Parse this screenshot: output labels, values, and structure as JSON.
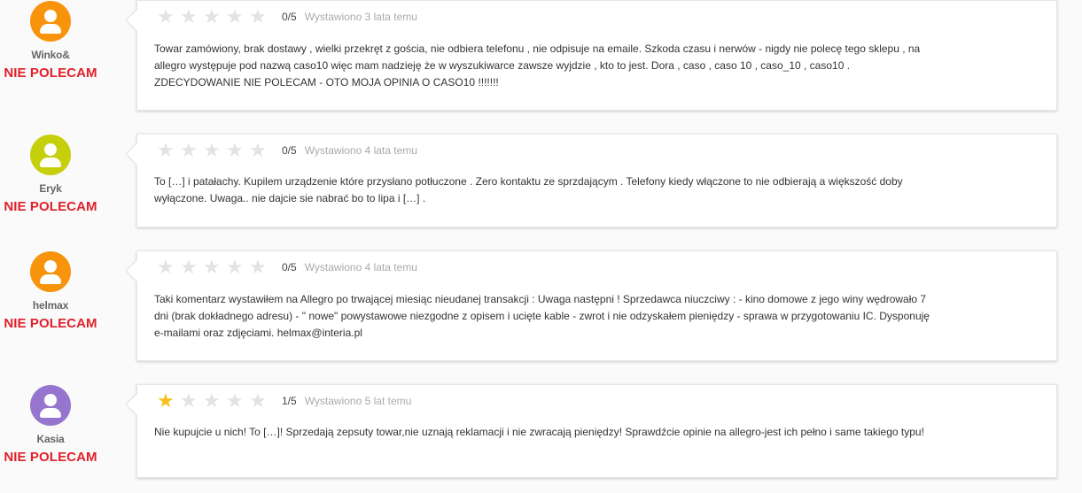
{
  "colors": {
    "verdict": "#e0202a",
    "star_on": "#f8c01e",
    "star_off": "#e3e3e3"
  },
  "reviews": [
    {
      "author": "Winko&",
      "avatar_color": "#f7940c",
      "verdict": "NIE POLECAM",
      "stars": 0,
      "score": "0/5",
      "posted": "Wystawiono 3 lata temu",
      "text": "Towar zamówiony, brak dostawy , wielki przekręt z gościa, nie odbiera telefonu , nie odpisuje na emaile. Szkoda czasu i nerwów - nigdy nie polecę tego sklepu , na allegro występuje pod nazwą caso10 więc mam nadzieję że w wyszukiwarce zawsze wyjdzie , kto to jest. Dora , caso , caso 10 , caso_10 , caso10 . ZDECYDOWANIE NIE POLECAM - OTO MOJA OPINIA O CASO10 !!!!!!!"
    },
    {
      "author": "Eryk",
      "avatar_color": "#c6cf0c",
      "verdict": "NIE POLECAM",
      "stars": 0,
      "score": "0/5",
      "posted": "Wystawiono 4 lata temu",
      "text": "To […] i patałachy. Kupilem urządzenie które przysłano potłuczone . Zero kontaktu ze sprzdającym . Telefony kiedy włączone to nie odbierają a większość doby wyłączone. Uwaga.. nie dajcie sie nabrać bo to lipa i […] ."
    },
    {
      "author": "helmax",
      "avatar_color": "#f7940c",
      "verdict": "NIE POLECAM",
      "stars": 0,
      "score": "0/5",
      "posted": "Wystawiono 4 lata temu",
      "text": "Taki komentarz wystawiłem na Allegro po trwającej miesiąc nieudanej transakcji : Uwaga następni ! Sprzedawca niuczciwy : - kino domowe z jego winy wędrowało 7 dni (brak dokładnego adresu) - \" nowe\" powystawowe niezgodne z opisem i ucięte kable - zwrot i nie odzyskałem pieniędzy - sprawa w przygotowaniu IC. Dysponuję e-mailami oraz zdjęciami. helmax@interia.pl"
    },
    {
      "author": "Kasia",
      "avatar_color": "#9575cd",
      "verdict": "NIE POLECAM",
      "stars": 1,
      "score": "1/5",
      "posted": "Wystawiono 5 lat temu",
      "text": "Nie kupujcie u nich! To […]! Sprzedają zepsuty towar,nie uznają reklamacji i nie zwracają pieniędzy! Sprawdźcie opinie na allegro-jest ich pełno i same takiego typu!"
    }
  ]
}
